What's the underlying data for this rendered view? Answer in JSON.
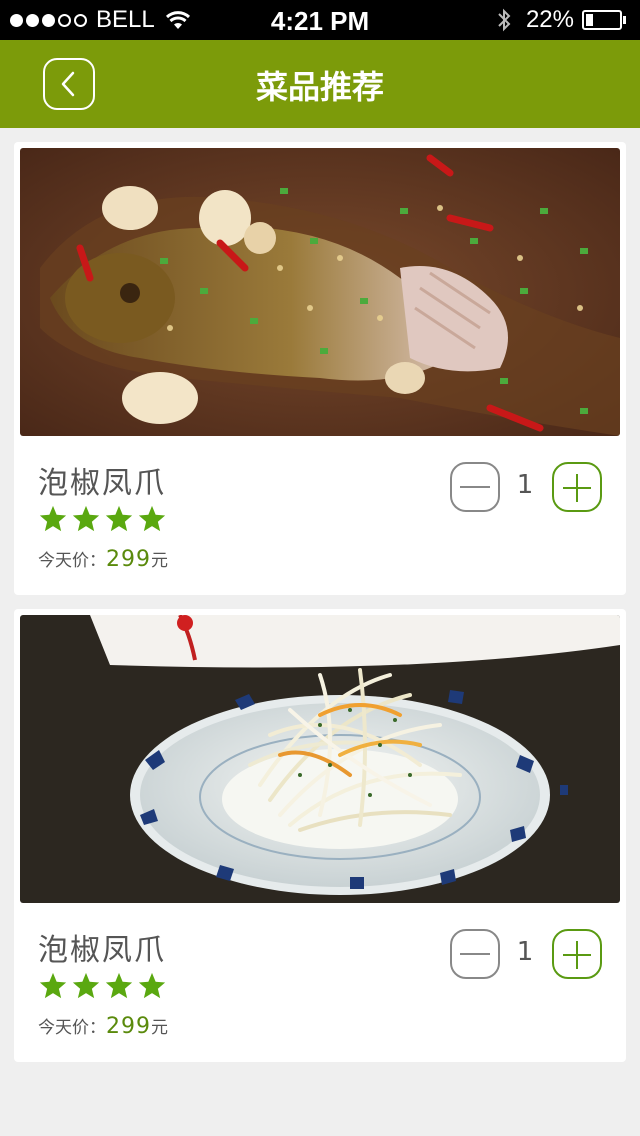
{
  "status_bar": {
    "carrier": "BELL",
    "time": "4:21 PM",
    "battery": "22%",
    "battery_level": 0.22,
    "signal_bars_filled": 3,
    "signal_bars_total": 5
  },
  "nav": {
    "title": "菜品推荐",
    "back_icon": "chevron-left-icon"
  },
  "colors": {
    "nav_green": "#7c9b0a",
    "star_green": "#5aa810",
    "price_green": "#5a8a0c",
    "plus_green": "#5a9a12"
  },
  "dishes": [
    {
      "name": "泡椒凤爪",
      "image": "braised-fish-photo",
      "rating": 4,
      "price_label": "今天价：",
      "price": "299",
      "price_unit": "元",
      "quantity": "1"
    },
    {
      "name": "泡椒凤爪",
      "image": "shredded-radish-salad-photo",
      "rating": 4,
      "price_label": "今天价：",
      "price": "299",
      "price_unit": "元",
      "quantity": "1"
    }
  ]
}
